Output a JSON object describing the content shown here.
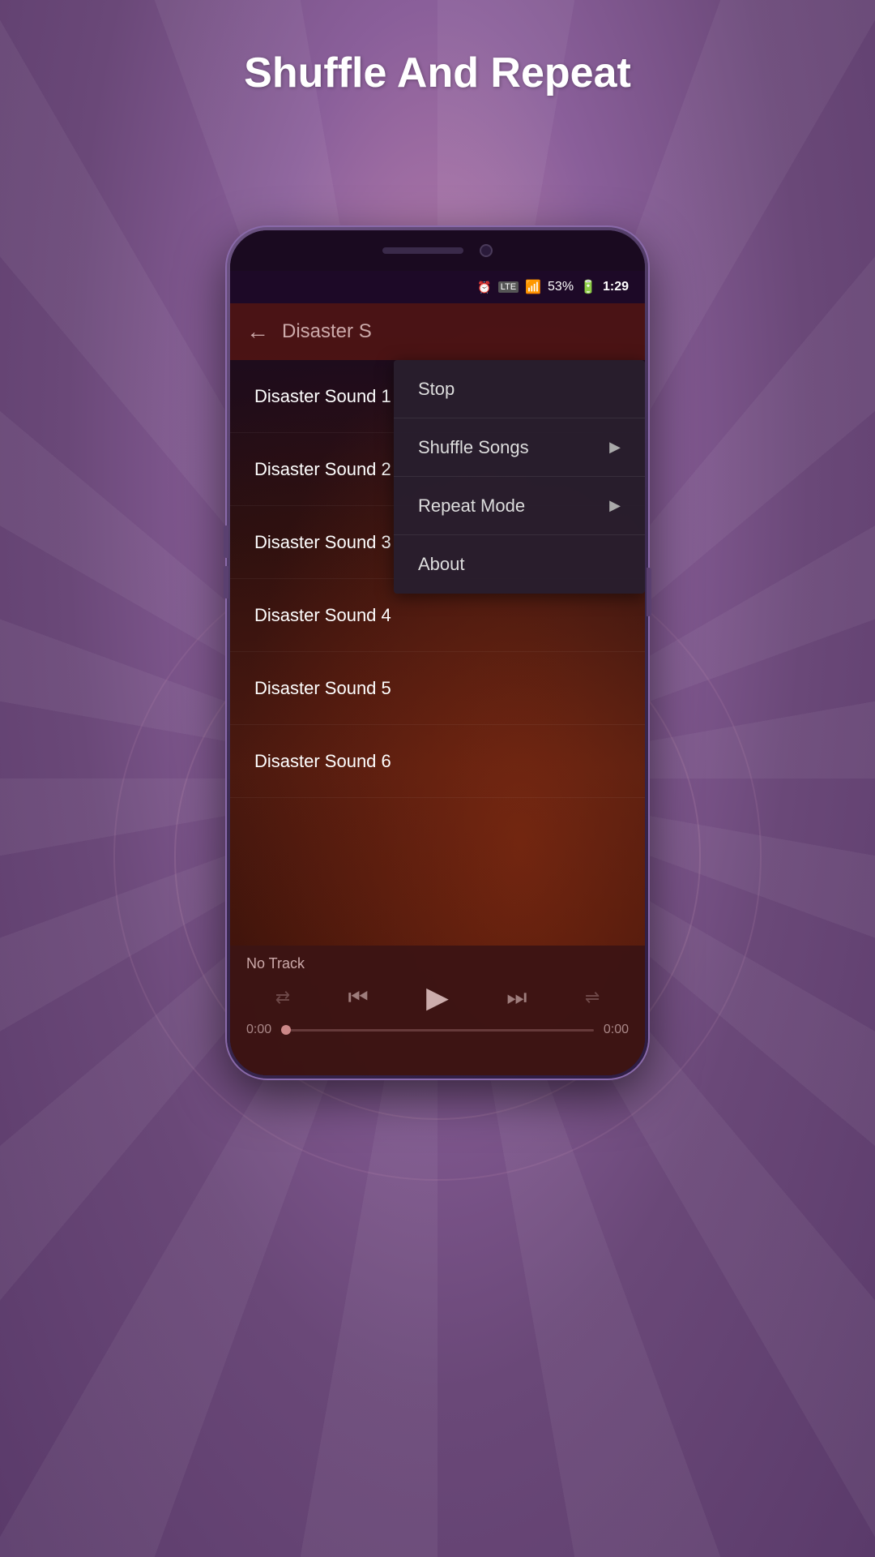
{
  "page": {
    "title": "Shuffle And Repeat"
  },
  "status_bar": {
    "battery": "53%",
    "time": "1:29",
    "lte": "LTE"
  },
  "app": {
    "title": "Disaster S",
    "back_label": "←"
  },
  "songs": [
    {
      "name": "Disaster Sound 1"
    },
    {
      "name": "Disaster Sound 2"
    },
    {
      "name": "Disaster Sound 3"
    },
    {
      "name": "Disaster Sound 4"
    },
    {
      "name": "Disaster Sound 5"
    },
    {
      "name": "Disaster Sound 6"
    }
  ],
  "menu": {
    "items": [
      {
        "label": "Stop",
        "has_arrow": false
      },
      {
        "label": "Shuffle Songs",
        "has_arrow": true
      },
      {
        "label": "Repeat Mode",
        "has_arrow": true
      },
      {
        "label": "About",
        "has_arrow": false
      }
    ]
  },
  "player": {
    "track": "No Track",
    "time_start": "0:00",
    "time_end": "0:00"
  },
  "icons": {
    "shuffle": "⇄",
    "prev": "⏮",
    "play": "▶",
    "next": "⏭",
    "repeat": "⇌"
  }
}
